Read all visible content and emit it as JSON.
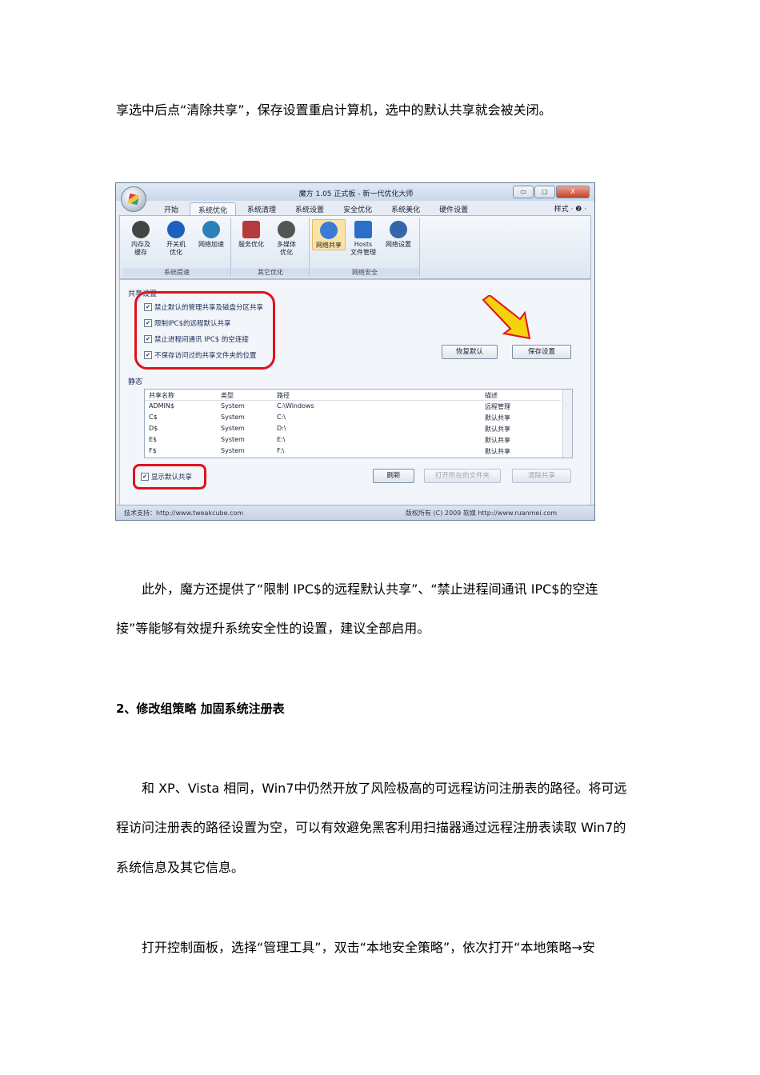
{
  "paragraphs": {
    "p1": "享选中后点“清除共享”，保存设置重启计算机，选中的默认共享就会被关闭。",
    "p2_line1": "此外，魔方还提供了“限制 IPC$的远程默认共享”、“禁止进程间通讯 IPC$的空连",
    "p2_line2": "接”等能够有效提升系统安全性的设置，建议全部启用。",
    "heading2": "2、修改组策略  加固系统注册表",
    "p3_line1": "和 XP、Vista 相同，Win7中仍然开放了风险极高的可远程访问注册表的路径。将可远",
    "p3_line2": "程访问注册表的路径设置为空，可以有效避免黑客利用扫描器通过远程注册表读取 Win7的",
    "p3_line3": "系统信息及其它信息。",
    "p4_line1": "打开控制面板，选择“管理工具”，双击“本地安全策略”，依次打开“本地策略→安"
  },
  "screenshot": {
    "window_title": "魔方 1.05 正式板 - 新一代优化大师",
    "window_buttons": [
      "▭",
      "▢",
      "X"
    ],
    "tabs": [
      "开始",
      "系统优化",
      "系统清理",
      "系统设置",
      "安全优化",
      "系统美化",
      "硬件设置"
    ],
    "style_menu": "样式 · ❷ ·",
    "ribbon_groups": [
      {
        "label": "系统提速",
        "buttons": [
          {
            "text": "内存及\n缓存",
            "icon": "memory-icon",
            "color": "#333"
          },
          {
            "text": "开关机\n优化",
            "icon": "power-icon",
            "color": "#1f5fbf"
          },
          {
            "text": "网络加速",
            "icon": "network-icon",
            "color": "#2c7fb8"
          }
        ]
      },
      {
        "label": "其它优化",
        "buttons": [
          {
            "text": "服务优化",
            "icon": "service-icon",
            "color": "#b83a3a"
          },
          {
            "text": "多媒体\n优化",
            "icon": "media-icon",
            "color": "#555"
          }
        ]
      },
      {
        "label": "网络安全",
        "buttons": [
          {
            "text": "网络共享",
            "icon": "share-icon",
            "color": "#3a7bd5"
          },
          {
            "text": "Hosts\n文件管理",
            "icon": "hosts-icon",
            "color": "#2a6fc9"
          },
          {
            "text": "网络设置",
            "icon": "netset-icon",
            "color": "#3366aa"
          }
        ]
      }
    ],
    "share_settings_label": "共享设置",
    "checkboxes": [
      "禁止默认的管理共享及磁盘分区共享",
      "限制IPC$的远程默认共享",
      "禁止进程间通讯 IPC$ 的空连接",
      "不保存访问过的共享文件夹的位置"
    ],
    "restore_button": "恢复默认",
    "save_button": "保存设置",
    "status_section_label": "静态",
    "list_headers": [
      "共享名称",
      "类型",
      "路径",
      "描述"
    ],
    "list_rows": [
      [
        "ADMIN$",
        "System",
        "C:\\Windows",
        "远程管理"
      ],
      [
        "C$",
        "System",
        "C:\\",
        "默认共享"
      ],
      [
        "D$",
        "System",
        "D:\\",
        "默认共享"
      ],
      [
        "E$",
        "System",
        "E:\\",
        "默认共享"
      ],
      [
        "F$",
        "System",
        "F:\\",
        "默认共享"
      ]
    ],
    "show_default_share": "显示默认共享",
    "refresh_button": "刷新",
    "open_folder_button": "打开所在的文件夹",
    "clear_share_button": "清除共享",
    "status_left": "技术支持：http://www.tweakcube.com",
    "status_right": "版权所有 (C) 2009 软媒 http://www.ruanmei.com",
    "highlight_color": "#e0121b",
    "arrow_color": "#f5d30a"
  }
}
